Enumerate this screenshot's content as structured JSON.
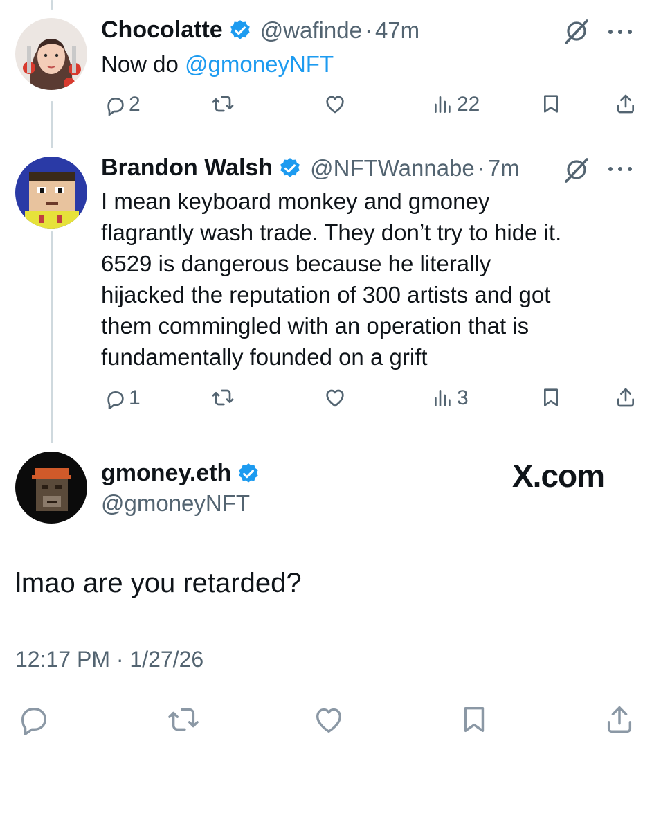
{
  "tweets": [
    {
      "name": "Chocolatte",
      "handle": "@wafinde",
      "separator": "·",
      "time": "47m",
      "text_prefix": "Now do ",
      "mention": "@gmoneyNFT",
      "replies": "2",
      "views": "22"
    },
    {
      "name": "Brandon Walsh",
      "handle": "@NFTWannabe",
      "separator": "·",
      "time": "7m",
      "text": "I mean keyboard monkey and gmoney\nflagrantly wash trade. They don’t try to hide it.\n6529 is dangerous because he literally\nhijacked the reputation of 300 artists and got\nthem commingled with an operation that is\nfundamentally founded on a grift",
      "replies": "1",
      "views": "3"
    }
  ],
  "main_post": {
    "name": "gmoney.eth",
    "handle": "@gmoneyNFT",
    "text": "lmao are you retarded?",
    "timestamp": "12:17 PM · 1/27/26"
  },
  "watermark": "X.com",
  "colors": {
    "link": "#1d9bf0",
    "verified": "#1d9bf0",
    "muted": "#536471",
    "thread_line": "#cfd9de"
  },
  "icons": [
    "reply-icon",
    "retweet-icon",
    "like-icon",
    "views-icon",
    "bookmark-icon",
    "share-icon",
    "grok-icon",
    "more-icon",
    "verified-icon"
  ]
}
